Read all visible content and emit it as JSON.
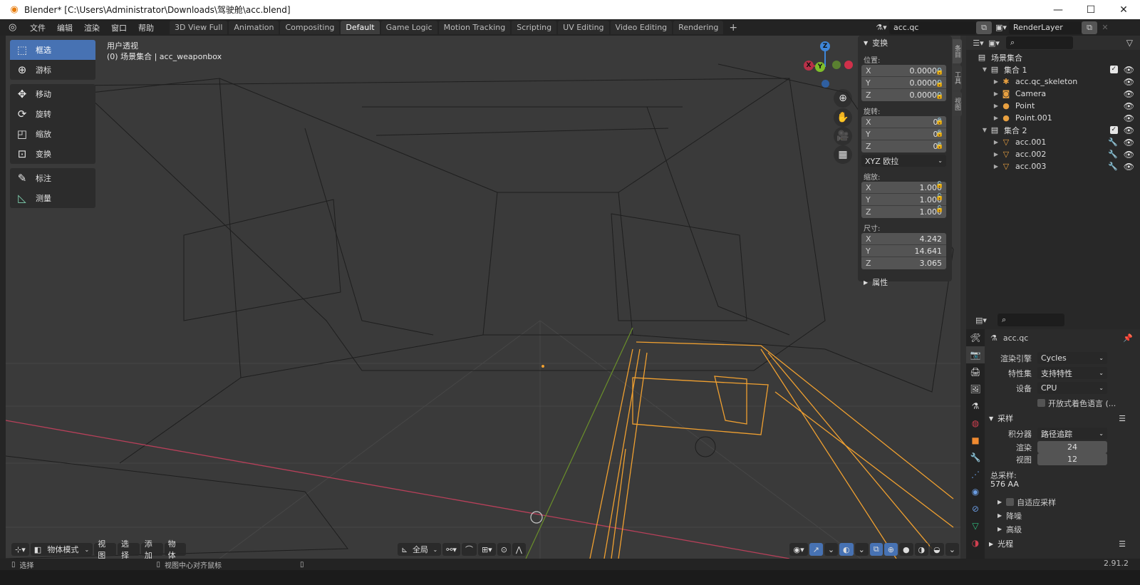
{
  "window": {
    "title": "Blender* [C:\\Users\\Administrator\\Downloads\\驾驶舱\\acc.blend]",
    "controls": [
      "minimize",
      "maximize",
      "close"
    ]
  },
  "menu": [
    "文件",
    "编辑",
    "渲染",
    "窗口",
    "帮助"
  ],
  "workspaces": [
    {
      "label": "3D View Full",
      "active": false
    },
    {
      "label": "Animation",
      "active": false
    },
    {
      "label": "Compositing",
      "active": false
    },
    {
      "label": "Default",
      "active": true
    },
    {
      "label": "Game Logic",
      "active": false
    },
    {
      "label": "Motion Tracking",
      "active": false
    },
    {
      "label": "Scripting",
      "active": false
    },
    {
      "label": "UV Editing",
      "active": false
    },
    {
      "label": "Video Editing",
      "active": false
    },
    {
      "label": "Rendering",
      "active": false
    }
  ],
  "workspace_add": "+",
  "scene": {
    "name": "acc.qc"
  },
  "view_layer": {
    "name": "RenderLayer"
  },
  "toolbar": [
    {
      "label": "框选",
      "icon": "select-box-icon",
      "active": true
    },
    {
      "label": "游标",
      "icon": "cursor-icon",
      "active": false
    },
    {
      "label": "移动",
      "icon": "move-icon",
      "active": false
    },
    {
      "label": "旋转",
      "icon": "rotate-icon",
      "active": false
    },
    {
      "label": "缩放",
      "icon": "scale-icon",
      "active": false
    },
    {
      "label": "变换",
      "icon": "transform-icon",
      "active": false
    },
    {
      "label": "标注",
      "icon": "annotate-icon",
      "active": false
    },
    {
      "label": "测量",
      "icon": "measure-icon",
      "active": false
    }
  ],
  "viewport": {
    "view_name": "用户透视",
    "context": "(0) 场景集合 | acc_weaponbox",
    "gizmo": {
      "x": "X",
      "y": "Y",
      "z": "Z"
    }
  },
  "npanel": {
    "header": "变换",
    "location_label": "位置:",
    "location": {
      "x": "0.00000",
      "y": "0.00000",
      "z": "0.00000"
    },
    "rotation_label": "旋转:",
    "rotation": {
      "x": "0°",
      "y": "0°",
      "z": "0°"
    },
    "rotation_mode": "XYZ 欧拉",
    "scale_label": "缩放:",
    "scale": {
      "x": "1.000",
      "y": "1.000",
      "z": "1.000"
    },
    "dimensions_label": "尺寸:",
    "dimensions": {
      "x": "4.242",
      "y": "14.641",
      "z": "3.065"
    },
    "properties_section": "属性",
    "axis": {
      "x": "X",
      "y": "Y",
      "z": "Z"
    },
    "side_tabs": [
      "条目",
      "工具",
      "视图"
    ]
  },
  "outliner": {
    "root": "场景集合",
    "collections": [
      {
        "name": "集合 1",
        "items": [
          {
            "name": "acc.qc_skeleton",
            "icon": "armature-icon"
          },
          {
            "name": "Camera",
            "icon": "camera-icon"
          },
          {
            "name": "Point",
            "icon": "light-icon"
          },
          {
            "name": "Point.001",
            "icon": "light-icon"
          }
        ]
      },
      {
        "name": "集合 2",
        "items": [
          {
            "name": "acc.001",
            "icon": "mesh-icon"
          },
          {
            "name": "acc.002",
            "icon": "mesh-icon"
          },
          {
            "name": "acc.003",
            "icon": "mesh-icon"
          }
        ]
      }
    ]
  },
  "properties": {
    "scene_name": "acc.qc",
    "render_engine_label": "渲染引擎",
    "render_engine": "Cycles",
    "feature_set_label": "特性集",
    "feature_set": "支持特性",
    "device_label": "设备",
    "device": "CPU",
    "osl_label": "开放式着色语言 (...",
    "sampling_section": "采样",
    "integrator_label": "积分器",
    "integrator": "路径追踪",
    "render_label": "渲染",
    "render_samples": "24",
    "viewport_label": "视图",
    "viewport_samples": "12",
    "total_samples_label": "总采样:",
    "total_samples": "576 AA",
    "adaptive_sampling": "自适应采样",
    "denoising": "降噪",
    "advanced": "高级",
    "light_paths": "光程"
  },
  "viewport_header": {
    "mode": "物体模式",
    "menus": [
      "视图",
      "选择",
      "添加",
      "物体"
    ],
    "orientation": "全局"
  },
  "statusbar": {
    "left_action": "选择",
    "middle_action": "视图中心对齐鼠标",
    "version": "2.91.2"
  },
  "colors": {
    "accent_blue": "#4772b3",
    "selection_orange": "#f0a030",
    "axis_x": "#d0304a",
    "axis_y": "#7fbf2a",
    "axis_z": "#3e86d8"
  }
}
